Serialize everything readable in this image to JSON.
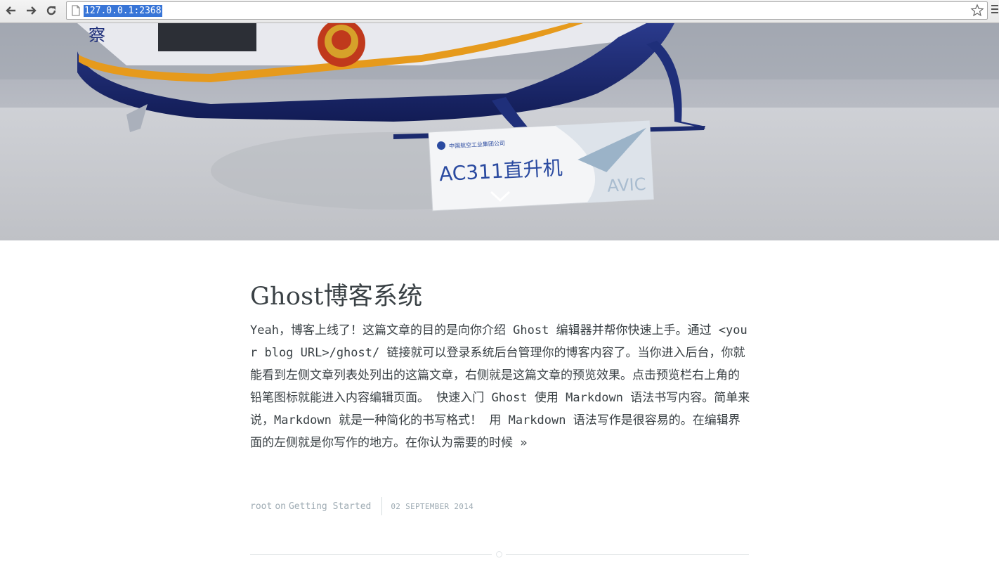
{
  "browser": {
    "url": "127.0.0.1:2368",
    "icons": [
      "back-arrow-icon",
      "forward-arrow-icon",
      "reload-icon",
      "page-icon",
      "star-icon",
      "menu-icon"
    ]
  },
  "hero": {
    "sign_text": "AC311直升机",
    "sign_brand": "AVIC",
    "sign_company": "中国航空工业集团公司",
    "emblem_text": "察",
    "scroll_icon": "chevron-down-icon"
  },
  "post": {
    "title": "Ghost博客系统",
    "excerpt": "Yeah，博客上线了！这篇文章的目的是向你介绍 Ghost 编辑器并帮你快速上手。通过 <your blog URL>/ghost/ 链接就可以登录系统后台管理你的博客内容了。当你进入后台，你就能看到左侧文章列表处列出的这篇文章，右侧就是这篇文章的预览效果。点击预览栏右上角的铅笔图标就能进入内容编辑页面。 快速入门 Ghost 使用 Markdown 语法书写内容。简单来说，Markdown 就是一种简化的书写格式！ 用 Markdown 语法写作是很容易的。在编辑界面的左侧就是你写作的地方。在你认为需要的时候",
    "read_more": "»",
    "author": "root",
    "on": "on",
    "tag": "Getting Started",
    "date": "02 SEPTEMBER 2014"
  },
  "colors": {
    "text": "#3a4145",
    "meta": "#9eabb3",
    "url_highlight": "#3875d7",
    "helicopter_blue": "#1f2f7a",
    "stripe_orange": "#e69a1c"
  }
}
